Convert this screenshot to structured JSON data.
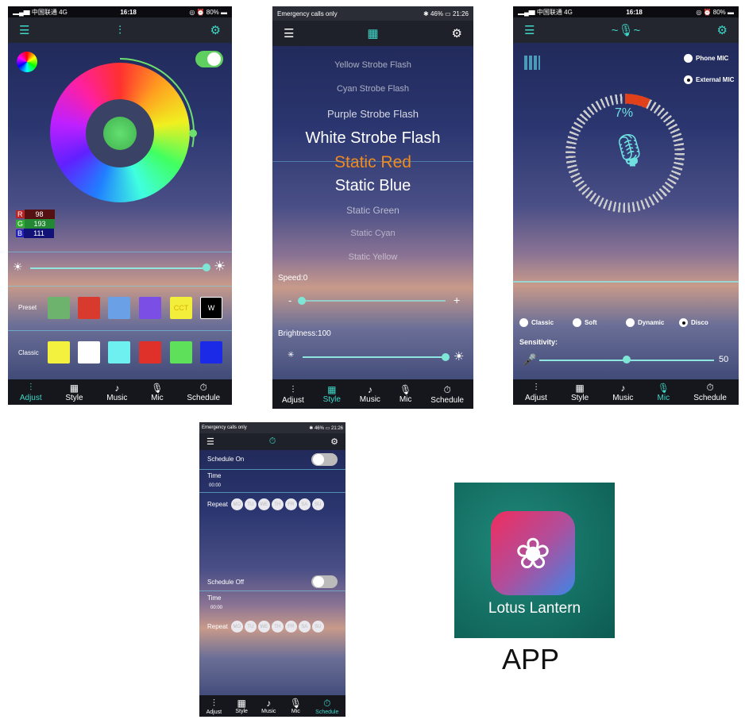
{
  "status_cn": {
    "carrier": "中国联通",
    "network": "4G",
    "time": "16:18",
    "battery": "80%"
  },
  "status_android": {
    "left": "Emergency calls only",
    "battery": "46%",
    "time": "21:26"
  },
  "nav": [
    "Adjust",
    "Style",
    "Music",
    "Mic",
    "Schedule"
  ],
  "adjust": {
    "power_on": true,
    "rgb": {
      "r_label": "R",
      "r": "98",
      "g_label": "G",
      "g": "193",
      "b_label": "B",
      "b": "111"
    },
    "brightness": 0.95,
    "preset_label": "Preset",
    "preset_colors": [
      "#6db36d",
      "#d93a2e",
      "#6aa0e6",
      "#7b4ee6",
      "#f2ee3a",
      "#000000"
    ],
    "preset_texts": [
      "",
      "",
      "",
      "",
      "CCT",
      "W"
    ],
    "classic_label": "Classic",
    "classic_colors": [
      "#f3f13e",
      "#ffffff",
      "#6ff0f0",
      "#e0302a",
      "#5ee05a",
      "#1a2ae6"
    ],
    "current_color": "#62c16f",
    "accent": "#3fd8c8"
  },
  "style": {
    "items": [
      "Yellow Strobe Flash",
      "Cyan Strobe Flash",
      "Purple Strobe Flash",
      "White Strobe Flash",
      "Static Red",
      "Static Blue",
      "Static Green",
      "Static Cyan",
      "Static Yellow"
    ],
    "selected": "Static Red",
    "speed_label": "Speed:0",
    "speed": 0,
    "minus": "-",
    "plus": "+",
    "brightness_label": "Brightness:100",
    "brightness": 100
  },
  "mic": {
    "phone_mic": "Phone MIC",
    "external_mic": "External MIC",
    "selected_mic": "External MIC",
    "percent": "7%",
    "modes": [
      "Classic",
      "Soft",
      "Dynamic",
      "Disco"
    ],
    "selected_mode": "Disco",
    "sensitivity_label": "Sensitivity:",
    "sensitivity": "50"
  },
  "schedule": {
    "on_label": "Schedule On",
    "off_label": "Schedule Off",
    "time_label": "Time",
    "time1": "00:00",
    "time2": "00:00",
    "repeat_label": "Repeat",
    "days": [
      "MO",
      "TU",
      "WE",
      "TH",
      "FR",
      "SA",
      "SU"
    ]
  },
  "app": {
    "name": "Lotus Lantern",
    "caption": "APP"
  }
}
